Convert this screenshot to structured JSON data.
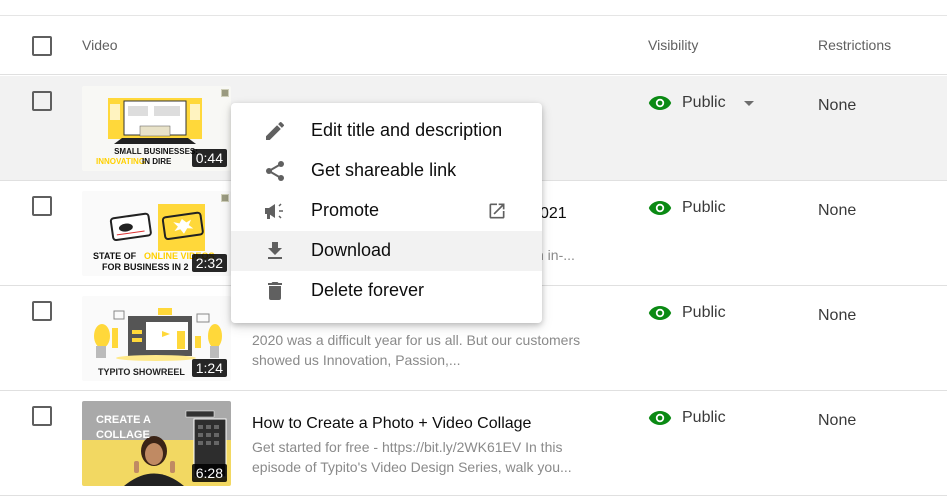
{
  "table": {
    "columns": {
      "video": "Video",
      "visibility": "Visibility",
      "restrictions": "Restrictions"
    },
    "rows": [
      {
        "thumb_caption_1": "SMALL BUSINESSES:",
        "thumb_caption_2a": "INNOVATING",
        "thumb_caption_2b": " IN DIRE",
        "duration": "0:44",
        "title": "",
        "description": "",
        "visibility": "Public",
        "restrictions": "None",
        "hovered": true
      },
      {
        "thumb_caption_1a": "STATE OF ",
        "thumb_caption_1b": "ONLINE VIDEOS",
        "thumb_caption_2": "FOR BUSINESS IN 2",
        "duration": "2:32",
        "title_visible_fragment": "021",
        "description_visible_fragment": "n in-...",
        "visibility": "Public",
        "restrictions": "None"
      },
      {
        "thumb_caption": "TYPITO SHOWREEL",
        "duration": "1:24",
        "description": "2020 was a difficult year for us all. But our customers showed us Innovation, Passion,...",
        "visibility": "Public",
        "restrictions": "None"
      },
      {
        "thumb_caption_1": "CREATE A",
        "thumb_caption_2": "COLLAGE",
        "duration": "6:28",
        "title": "How to Create a Photo + Video Collage",
        "description": "Get started for free - https://bit.ly/2WK61EV In this episode of Typito's Video Design Series, walk you...",
        "visibility": "Public",
        "restrictions": "None"
      }
    ]
  },
  "context_menu": {
    "items": [
      {
        "label": "Edit title and description",
        "icon": "pencil-icon"
      },
      {
        "label": "Get shareable link",
        "icon": "share-icon"
      },
      {
        "label": "Promote",
        "icon": "megaphone-icon",
        "trailing_icon": "open-in-new-icon"
      },
      {
        "label": "Download",
        "icon": "download-icon",
        "highlighted": true
      },
      {
        "label": "Delete forever",
        "icon": "trash-icon"
      }
    ]
  },
  "colors": {
    "visibility_icon": "#0b8a14",
    "thumbnail_accent": "#ffd83a",
    "row_hover": "#f2f2f2"
  }
}
